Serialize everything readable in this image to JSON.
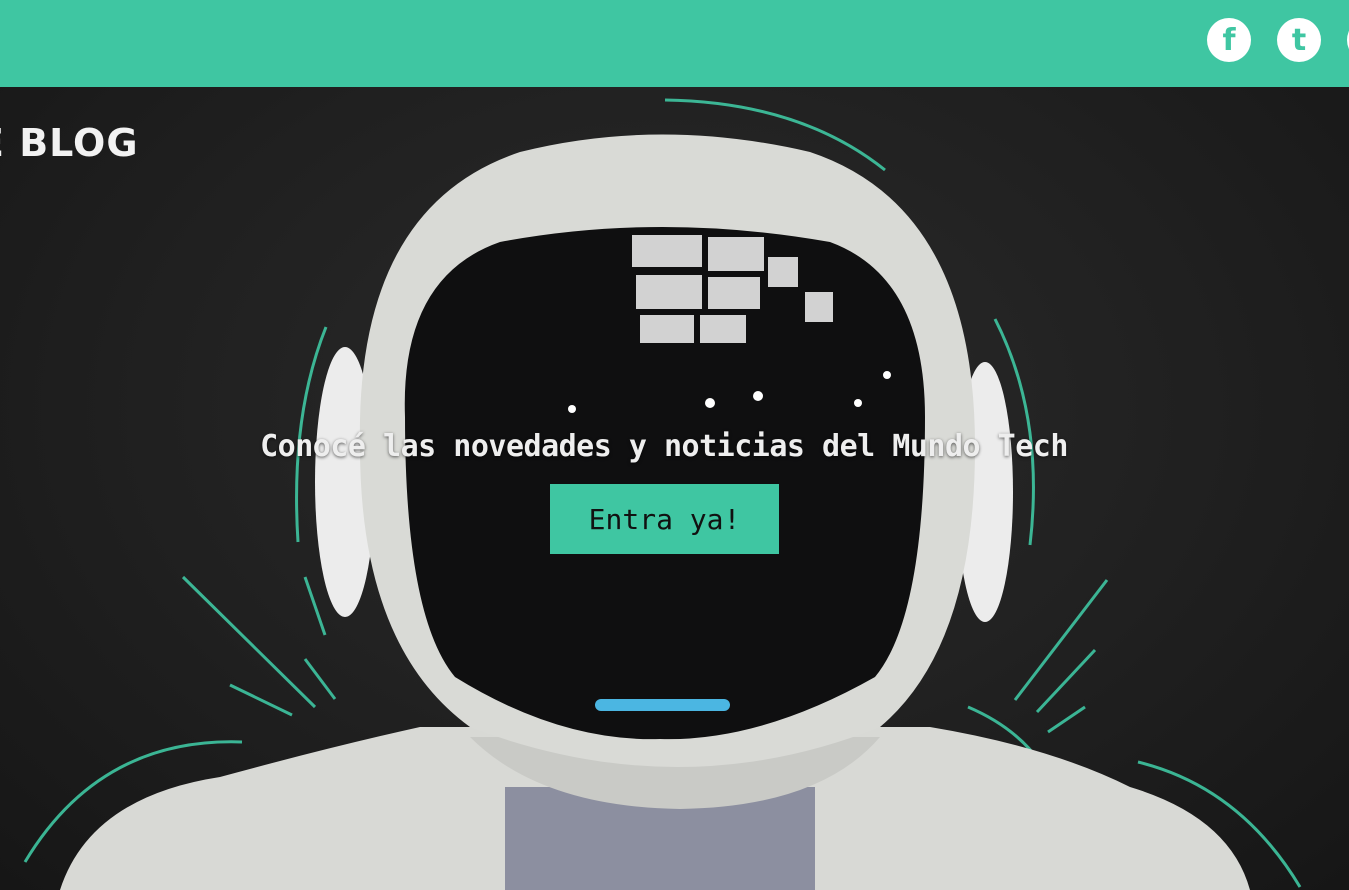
{
  "colors": {
    "accent": "#3fc6a2",
    "hero_background": "#1c1c1c",
    "text": "#eeeeee"
  },
  "header": {
    "social": [
      {
        "name": "facebook-icon",
        "glyph": "f"
      },
      {
        "name": "tumblr-icon",
        "glyph": "t"
      }
    ]
  },
  "hero": {
    "logo": "E BLOG",
    "tagline": "Conocé las novedades y noticias del Mundo Tech",
    "cta_label": "Entra ya!"
  }
}
